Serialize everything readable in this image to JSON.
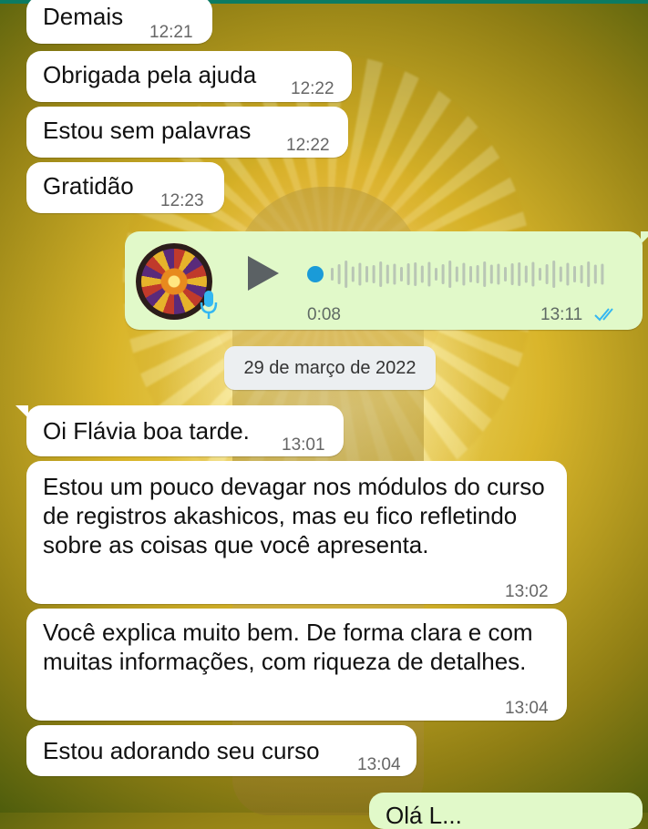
{
  "messages_earlier": [
    {
      "text": "Demais",
      "time": "12:21"
    },
    {
      "text": "Obrigada pela ajuda",
      "time": "12:22"
    },
    {
      "text": "Estou sem palavras",
      "time": "12:22"
    },
    {
      "text": "Gratidão",
      "time": "12:23"
    }
  ],
  "voice_message": {
    "duration": "0:08",
    "time": "13:11",
    "progress": 0,
    "status": "read",
    "ticks_color": "#34b7f1",
    "mic_color": "#34b7f1"
  },
  "date_separator": "29 de março de 2022",
  "messages_later": [
    {
      "text": "Oi Flávia boa tarde.",
      "time": "13:01"
    },
    {
      "text": "Estou um pouco devagar nos módulos do curso de registros akashicos, mas eu fico refletindo sobre as coisas que você apresenta.",
      "time": "13:02"
    },
    {
      "text": "Você explica muito bem.  De forma clara e com muitas informações, com riqueza de detalhes.",
      "time": "13:04"
    },
    {
      "text": "Estou adorando seu curso",
      "time": "13:04"
    }
  ],
  "outgoing_partial": {
    "text": "Olá L..."
  },
  "colors": {
    "incoming_bubble": "#ffffff",
    "outgoing_bubble": "#e1f9c9",
    "header_accent": "#0c7b62"
  },
  "icons": [
    "play-icon",
    "microphone-icon",
    "double-check-icon",
    "waveform"
  ]
}
